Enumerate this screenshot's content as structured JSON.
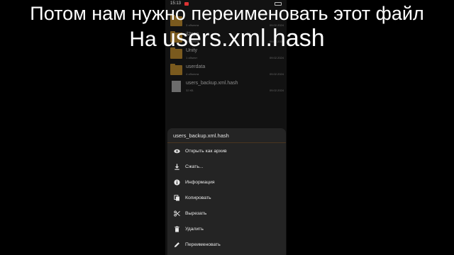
{
  "status_bar": {
    "time": "15:13"
  },
  "caption": {
    "line1": "Потом нам нужно переименовать этот файл",
    "line2_prefix": "На",
    "line2_filename": "users.xml.hash"
  },
  "file_list": {
    "path_pill": "...",
    "items": [
      {
        "name": "",
        "meta": "3 объекта",
        "date": "09.02.2024",
        "type": "folder"
      },
      {
        "name": "il2cpp",
        "meta": "3 объекта",
        "date": "09.02.2024",
        "type": "folder"
      },
      {
        "name": "Unity",
        "meta": "1 объект",
        "date": "09.02.2024",
        "type": "folder"
      },
      {
        "name": "userdata",
        "meta": "4 объекта",
        "date": "09.02.2024",
        "type": "folder"
      },
      {
        "name": "users_backup.xml.hash",
        "meta": "32 КБ",
        "date": "09.02.2024",
        "type": "file"
      }
    ]
  },
  "sheet": {
    "title": "users_backup.xml.hash",
    "items": [
      {
        "label": "Открыть как архив",
        "icon": "eye-icon"
      },
      {
        "label": "Сжать...",
        "icon": "download-icon"
      },
      {
        "label": "Информация",
        "icon": "info-icon"
      },
      {
        "label": "Копировать",
        "icon": "copy-icon"
      },
      {
        "label": "Вырезать",
        "icon": "scissors-icon"
      },
      {
        "label": "Удалить",
        "icon": "trash-icon"
      },
      {
        "label": "Переименовать",
        "icon": "pencil-icon"
      }
    ]
  },
  "colors": {
    "folder": "#7a5a1e",
    "sheet_bg": "#242424",
    "accent_divider": "#4a3520"
  }
}
